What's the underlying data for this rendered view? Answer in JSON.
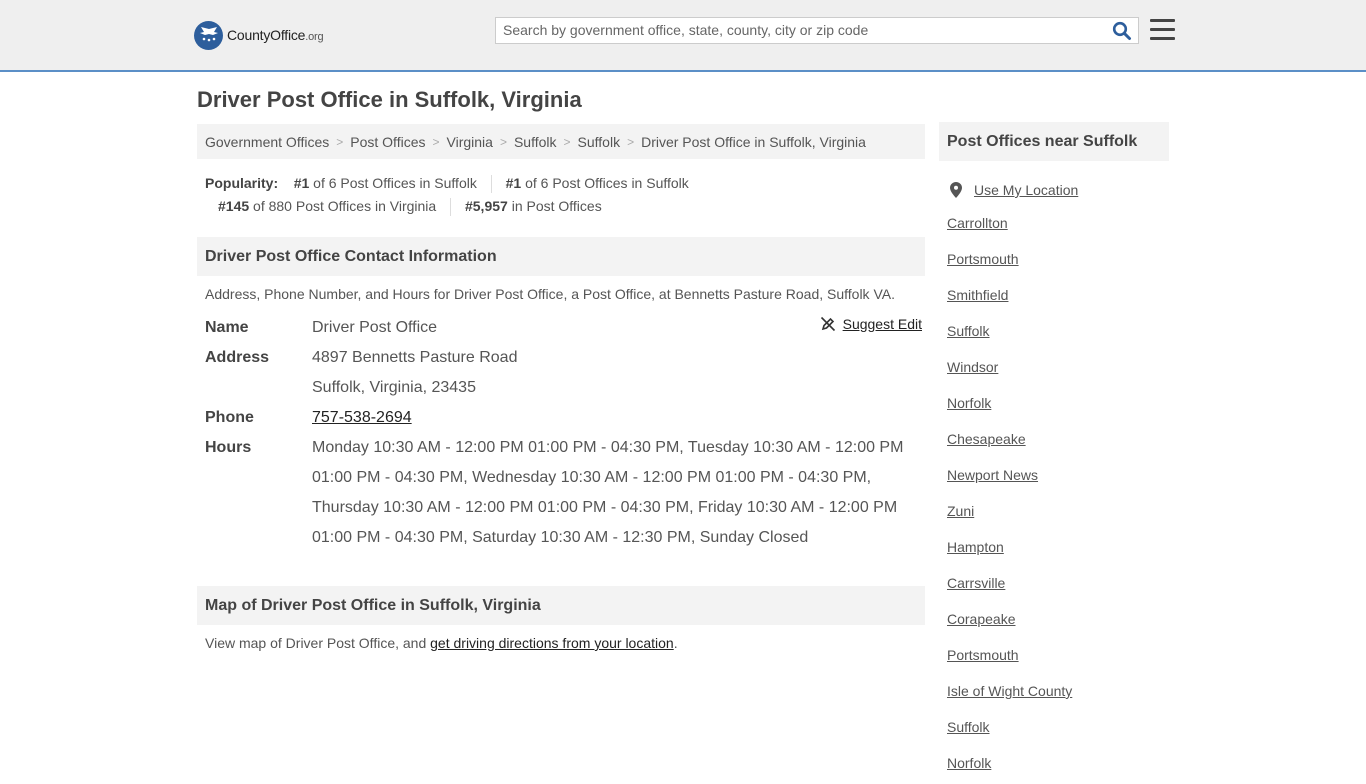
{
  "header": {
    "logo_name": "CountyOffice",
    "logo_tld": ".org",
    "search_placeholder": "Search by government office, state, county, city or zip code"
  },
  "page_title": "Driver Post Office in Suffolk, Virginia",
  "breadcrumb": [
    "Government Offices",
    "Post Offices",
    "Virginia",
    "Suffolk",
    "Suffolk",
    "Driver Post Office in Suffolk, Virginia"
  ],
  "popularity": {
    "label": "Popularity:",
    "items": [
      {
        "rank": "#1",
        "text": "of 6 Post Offices in Suffolk"
      },
      {
        "rank": "#1",
        "text": "of 6 Post Offices in Suffolk"
      },
      {
        "rank": "#145",
        "text": "of 880 Post Offices in Virginia"
      },
      {
        "rank": "#5,957",
        "text": "in Post Offices"
      }
    ]
  },
  "contact": {
    "heading": "Driver Post Office Contact Information",
    "description": "Address, Phone Number, and Hours for Driver Post Office, a Post Office, at Bennetts Pasture Road, Suffolk VA.",
    "suggest_edit": "Suggest Edit",
    "name_label": "Name",
    "name": "Driver Post Office",
    "address_label": "Address",
    "address_line1": "4897 Bennetts Pasture Road",
    "address_line2": "Suffolk, Virginia, 23435",
    "phone_label": "Phone",
    "phone": "757-538-2694",
    "hours_label": "Hours",
    "hours_lines": [
      "Monday 10:30 AM - 12:00 PM 01:00 PM - 04:30 PM, Tuesday 10:30 AM - 12:00 PM",
      "01:00 PM - 04:30 PM, Wednesday 10:30 AM - 12:00 PM 01:00 PM - 04:30 PM,",
      "Thursday 10:30 AM - 12:00 PM 01:00 PM - 04:30 PM, Friday 10:30 AM - 12:00 PM",
      "01:00 PM - 04:30 PM, Saturday 10:30 AM - 12:30 PM, Sunday Closed"
    ]
  },
  "map": {
    "heading": "Map of Driver Post Office in Suffolk, Virginia",
    "text_before": "View map of Driver Post Office, and ",
    "link": "get driving directions from your location",
    "text_after": "."
  },
  "sidebar": {
    "heading": "Post Offices near Suffolk",
    "use_location": "Use My Location",
    "items": [
      "Carrollton",
      "Portsmouth",
      "Smithfield",
      "Suffolk",
      "Windsor",
      "Norfolk",
      "Chesapeake",
      "Newport News",
      "Zuni",
      "Hampton",
      "Carrsville",
      "Corapeake",
      "Portsmouth",
      "Isle of Wight County",
      "Suffolk",
      "Norfolk"
    ]
  }
}
